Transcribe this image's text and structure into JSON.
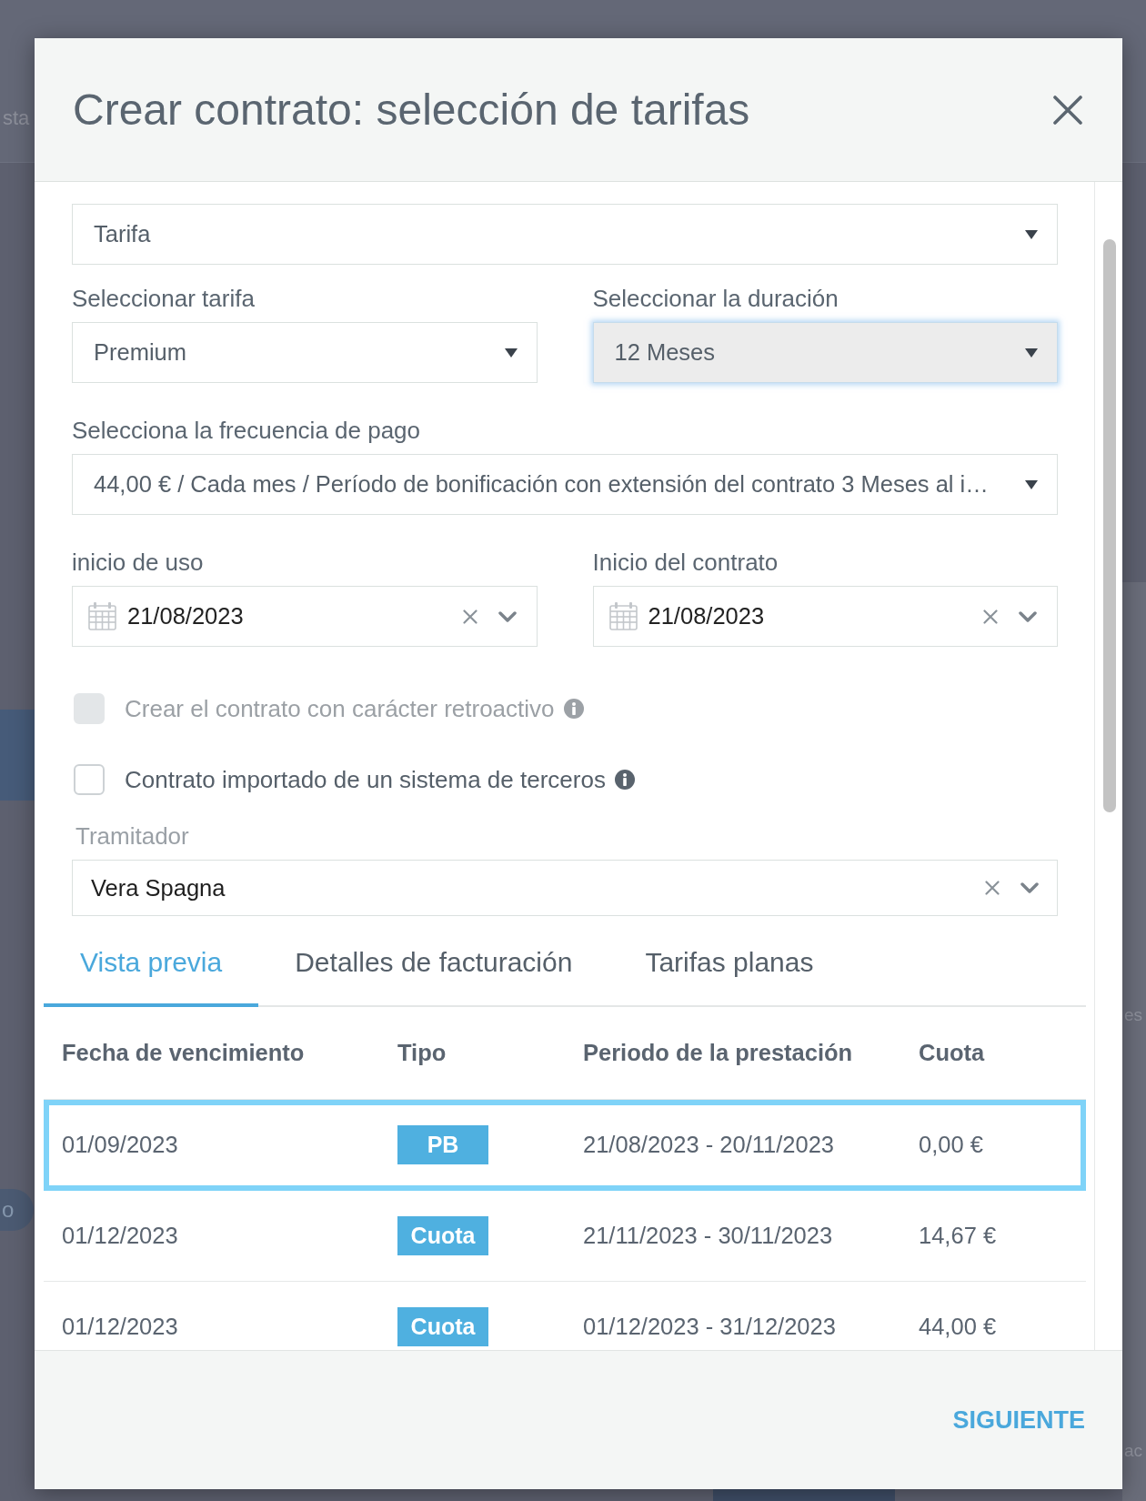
{
  "background": {
    "top_left_text": "sta",
    "left_pill_text": "o",
    "right_panel_texts": [
      "es",
      "ac"
    ]
  },
  "dialog": {
    "title": "Crear contrato: selección de tarifas"
  },
  "form": {
    "rows": [
      [
        {
          "kind": "select",
          "value": "Tarifa",
          "focused": false
        }
      ],
      [
        {
          "kind": "select",
          "label": "Seleccionar tarifa",
          "value": "Premium",
          "focused": false
        },
        {
          "kind": "select",
          "label": "Seleccionar la duración",
          "value": "12 Meses",
          "focused": true
        }
      ],
      [
        {
          "kind": "select",
          "label": "Selecciona la frecuencia de pago",
          "value": "44,00 € / Cada mes / Período de bonificación con extensión del contrato 3 Meses al i…",
          "focused": false
        }
      ],
      [
        {
          "kind": "date",
          "label": "inicio de uso",
          "value": "21/08/2023",
          "focused": false
        },
        {
          "kind": "date",
          "label": "Inicio del contrato",
          "value": "21/08/2023",
          "focused": false
        }
      ]
    ],
    "checkboxes": [
      {
        "label": "Crear el contrato con carácter retroactivo",
        "checked": false,
        "disabled": true
      },
      {
        "label": "Contrato importado de un sistema de terceros",
        "checked": false,
        "disabled": false
      }
    ],
    "processor": {
      "kind": "combobox",
      "label": "Tramitador",
      "value": "Vera Spagna",
      "focused": false
    }
  },
  "tabs": [
    {
      "label": "Vista previa",
      "selected": true
    },
    {
      "label": "Detalles de facturación",
      "selected": false
    },
    {
      "label": "Tarifas planas",
      "selected": false
    }
  ],
  "table": {
    "columns": [
      {
        "label": "Fecha de vencimiento",
        "kind": "text"
      },
      {
        "label": "Tipo",
        "kind": "badge"
      },
      {
        "label": "Periodo de la prestación",
        "kind": "text"
      },
      {
        "label": "Cuota",
        "kind": "text"
      }
    ],
    "rows": [
      {
        "cells": [
          "01/09/2023",
          "PB",
          "21/08/2023 - 20/11/2023",
          "0,00 €"
        ],
        "selected": true
      },
      {
        "cells": [
          "01/12/2023",
          "Cuota",
          "21/11/2023 - 30/11/2023",
          "14,67 €"
        ],
        "selected": false
      },
      {
        "cells": [
          "01/12/2023",
          "Cuota",
          "01/12/2023 - 31/12/2023",
          "44,00 €"
        ],
        "selected": false
      }
    ]
  },
  "footer": {
    "next_button": "SIGUIENTE"
  }
}
